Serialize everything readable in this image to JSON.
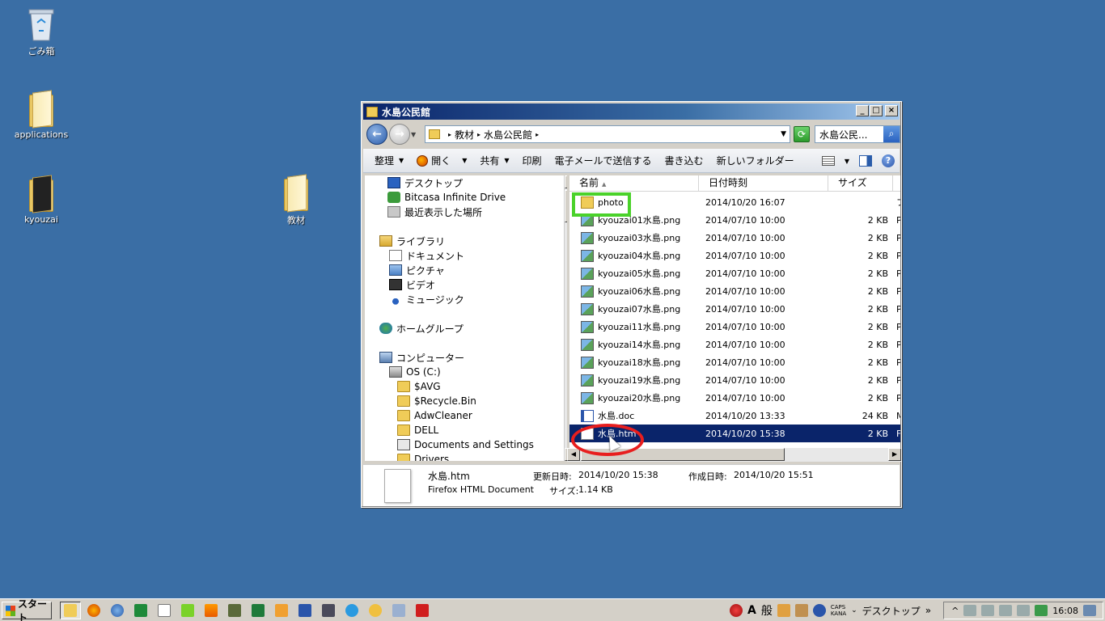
{
  "desktop": {
    "icons": [
      {
        "label": "ごみ箱"
      },
      {
        "label": "applications"
      },
      {
        "label": "kyouzai"
      },
      {
        "label": "教材"
      }
    ]
  },
  "window": {
    "title": "水島公民館",
    "address": {
      "segments": [
        "教材",
        "水島公民館"
      ]
    },
    "search_placeholder": "水島公民...",
    "toolbar": {
      "organize": "整理",
      "open": "開く",
      "share": "共有",
      "print": "印刷",
      "email": "電子メールで送信する",
      "burn": "書き込む",
      "new_folder": "新しいフォルダー"
    },
    "nav": {
      "items": [
        {
          "label": "デスクトップ"
        },
        {
          "label": "Bitcasa Infinite Drive"
        },
        {
          "label": "最近表示した場所"
        },
        {
          "label": "ライブラリ"
        },
        {
          "label": "ドキュメント"
        },
        {
          "label": "ピクチャ"
        },
        {
          "label": "ビデオ"
        },
        {
          "label": "ミュージック"
        },
        {
          "label": "ホームグループ"
        },
        {
          "label": "コンピューター"
        },
        {
          "label": "OS (C:)"
        },
        {
          "label": "$AVG"
        },
        {
          "label": "$Recycle.Bin"
        },
        {
          "label": "AdwCleaner"
        },
        {
          "label": "DELL"
        },
        {
          "label": "Documents and Settings"
        },
        {
          "label": "Drivers"
        }
      ]
    },
    "columns": {
      "name": "名前",
      "date": "日付時刻",
      "size": "サイズ",
      "type": "種"
    },
    "files": [
      {
        "name": "photo",
        "date": "2014/10/20 16:07",
        "size": "",
        "type": "フ",
        "icon": "folder"
      },
      {
        "name": "kyouzai01水島.png",
        "date": "2014/07/10 10:00",
        "size": "2 KB",
        "type": "P",
        "icon": "png"
      },
      {
        "name": "kyouzai03水島.png",
        "date": "2014/07/10 10:00",
        "size": "2 KB",
        "type": "P",
        "icon": "png"
      },
      {
        "name": "kyouzai04水島.png",
        "date": "2014/07/10 10:00",
        "size": "2 KB",
        "type": "P",
        "icon": "png"
      },
      {
        "name": "kyouzai05水島.png",
        "date": "2014/07/10 10:00",
        "size": "2 KB",
        "type": "P",
        "icon": "png"
      },
      {
        "name": "kyouzai06水島.png",
        "date": "2014/07/10 10:00",
        "size": "2 KB",
        "type": "P",
        "icon": "png"
      },
      {
        "name": "kyouzai07水島.png",
        "date": "2014/07/10 10:00",
        "size": "2 KB",
        "type": "P",
        "icon": "png"
      },
      {
        "name": "kyouzai11水島.png",
        "date": "2014/07/10 10:00",
        "size": "2 KB",
        "type": "P",
        "icon": "png"
      },
      {
        "name": "kyouzai14水島.png",
        "date": "2014/07/10 10:00",
        "size": "2 KB",
        "type": "P",
        "icon": "png"
      },
      {
        "name": "kyouzai18水島.png",
        "date": "2014/07/10 10:00",
        "size": "2 KB",
        "type": "P",
        "icon": "png"
      },
      {
        "name": "kyouzai19水島.png",
        "date": "2014/07/10 10:00",
        "size": "2 KB",
        "type": "P",
        "icon": "png"
      },
      {
        "name": "kyouzai20水島.png",
        "date": "2014/07/10 10:00",
        "size": "2 KB",
        "type": "P",
        "icon": "png"
      },
      {
        "name": "水島.doc",
        "date": "2014/10/20 13:33",
        "size": "24 KB",
        "type": "M",
        "icon": "doc"
      },
      {
        "name": "水島.htm",
        "date": "2014/10/20 15:38",
        "size": "2 KB",
        "type": "F",
        "icon": "htm",
        "selected": true
      }
    ],
    "details": {
      "filename": "水島.htm",
      "filetype": "Firefox HTML Document",
      "modified_label": "更新日時:",
      "modified": "2014/10/20 15:38",
      "created_label": "作成日時:",
      "created": "2014/10/20 15:51",
      "size_label": "サイズ:",
      "size": "1.14 KB"
    }
  },
  "taskbar": {
    "start": "スタート",
    "ime_a": "A",
    "ime_mode": "般",
    "caps": "CAPS",
    "kana": "KANA",
    "desktop_label": "デスクトップ",
    "chevron": "»",
    "clock": "16:08"
  },
  "colors": {
    "desktop": "#3a6ea5",
    "selection": "#0a246a",
    "highlight_green": "#4ad22a",
    "highlight_red": "#e81e1e"
  }
}
